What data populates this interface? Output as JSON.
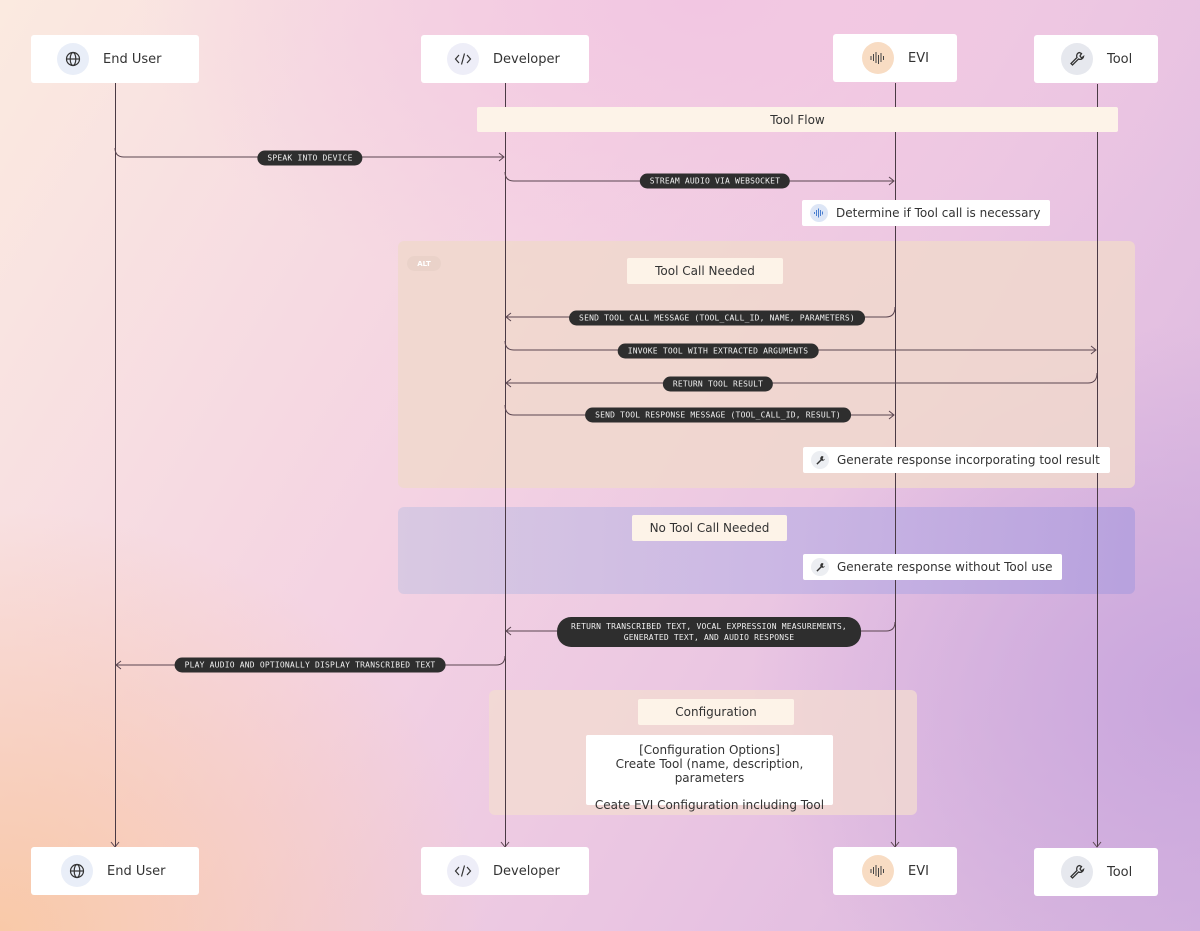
{
  "actors": [
    {
      "id": "end-user",
      "label": "End User",
      "icon": "globe-icon"
    },
    {
      "id": "developer",
      "label": "Developer",
      "icon": "code-icon"
    },
    {
      "id": "evi",
      "label": "EVI",
      "icon": "waveform-icon"
    },
    {
      "id": "tool",
      "label": "Tool",
      "icon": "wrench-icon"
    }
  ],
  "title_note": "Tool Flow",
  "messages": [
    {
      "from": "end-user",
      "to": "developer",
      "label": "SPEAK INTO DEVICE"
    },
    {
      "from": "developer",
      "to": "evi",
      "label": "STREAM AUDIO VIA WEBSOCKET"
    },
    {
      "from": "evi",
      "to": "developer",
      "label": "SEND TOOL CALL MESSAGE (TOOL_CALL_ID, NAME, PARAMETERS)"
    },
    {
      "from": "developer",
      "to": "tool",
      "label": "INVOKE TOOL WITH EXTRACTED ARGUMENTS"
    },
    {
      "from": "tool",
      "to": "developer",
      "label": "RETURN TOOL RESULT"
    },
    {
      "from": "developer",
      "to": "evi",
      "label": "SEND TOOL RESPONSE MESSAGE (TOOL_CALL_ID, RESULT)"
    },
    {
      "from": "evi",
      "to": "developer",
      "label_line1": "RETURN TRANSCRIBED TEXT, VOCAL EXPRESSION MEASUREMENTS,",
      "label_line2": "GENERATED TEXT, AND AUDIO RESPONSE"
    },
    {
      "from": "developer",
      "to": "end-user",
      "label": "PLAY AUDIO AND OPTIONALLY DISPLAY TRANSCRIBED TEXT"
    }
  ],
  "activities": {
    "determine": "Determine if Tool call is necessary",
    "with_tool": "Generate response incorporating tool result",
    "without_tool": "Generate response without Tool use"
  },
  "alt": {
    "badge": "ALT",
    "branch1": "Tool Call Needed",
    "branch2": "No Tool Call Needed"
  },
  "configuration": {
    "title": "Configuration",
    "line1": "[Configuration Options]",
    "line2": "Create Tool (name, description, parameters",
    "line3": "Ceate EVI Configuration including Tool"
  },
  "colors": {
    "pill_bg": "#2e2e2e",
    "note_bg": "#fdf3e8",
    "alt_frame": "#f0d8cc",
    "no_tool_frame": "#c7b2e0"
  }
}
